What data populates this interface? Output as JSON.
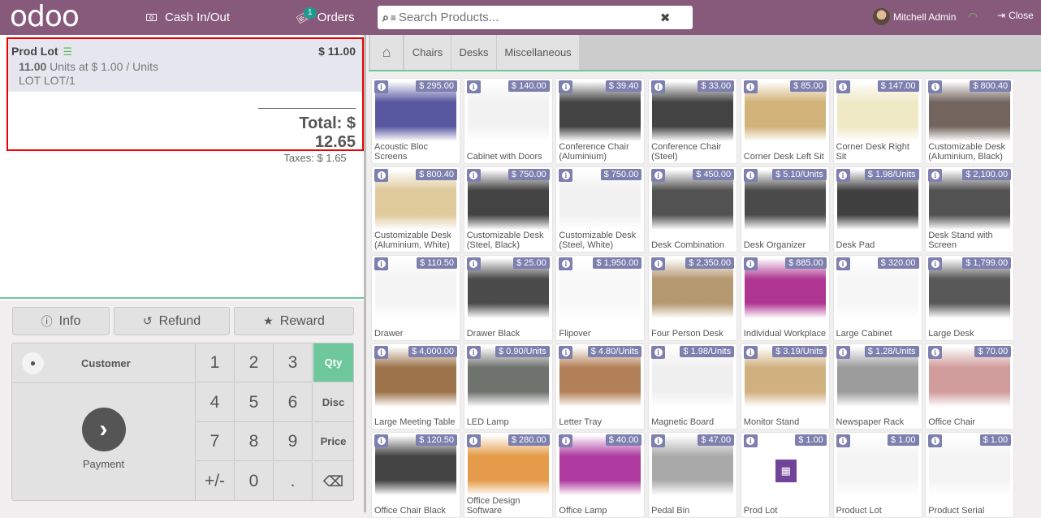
{
  "topbar": {
    "logo": "odoo",
    "cash_label": "Cash In/Out",
    "orders_label": "Orders",
    "orders_count": "1",
    "search_placeholder": "Search Products...",
    "user_name": "Mitchell Admin",
    "close_label": "Close"
  },
  "order": {
    "line": {
      "product": "Prod Lot",
      "price": "$ 11.00",
      "quantity": "11.00",
      "unit_info": "Units at $ 1.00 / Units",
      "lot": "LOT LOT/1"
    },
    "total": "Total: $ 12.65",
    "taxes": "Taxes: $ 1.65"
  },
  "actions": {
    "info": "Info",
    "refund": "Refund",
    "reward": "Reward"
  },
  "numpad": {
    "customer": "Customer",
    "payment": "Payment",
    "keys": [
      "1",
      "2",
      "3",
      "4",
      "5",
      "6",
      "7",
      "8",
      "9",
      "+/-",
      "0",
      "."
    ],
    "modes": [
      "Qty",
      "Disc",
      "Price"
    ],
    "active_mode": "Qty"
  },
  "categories": [
    "Chairs",
    "Desks",
    "Miscellaneous"
  ],
  "products": [
    {
      "name": "Acoustic Bloc Screens",
      "price": "$ 295.00",
      "color": "#3b3a8f"
    },
    {
      "name": "Cabinet with Doors",
      "price": "$ 140.00",
      "color": "#f0f0f0"
    },
    {
      "name": "Conference Chair (Aluminium)",
      "price": "$ 39.40",
      "color": "#222222"
    },
    {
      "name": "Conference Chair (Steel)",
      "price": "$ 33.00",
      "color": "#222222"
    },
    {
      "name": "Corner Desk Left Sit",
      "price": "$ 85.00",
      "color": "#c9a461"
    },
    {
      "name": "Corner Desk Right Sit",
      "price": "$ 147.00",
      "color": "#ece5bc"
    },
    {
      "name": "Customizable Desk (Aluminium, Black)",
      "price": "$ 800.40",
      "color": "#5a4a42"
    },
    {
      "name": "Customizable Desk (Aluminium, White)",
      "price": "$ 800.40",
      "color": "#d9c08a"
    },
    {
      "name": "Customizable Desk (Steel, Black)",
      "price": "$ 750.00",
      "color": "#222222"
    },
    {
      "name": "Customizable Desk (Steel, White)",
      "price": "$ 750.00",
      "color": "#eeeeee"
    },
    {
      "name": "Desk Combination",
      "price": "$ 450.00",
      "color": "#333333"
    },
    {
      "name": "Desk Organizer",
      "price": "$ 5.10/Units",
      "color": "#2a2a2a"
    },
    {
      "name": "Desk Pad",
      "price": "$ 1.98/Units",
      "color": "#1e1e1e"
    },
    {
      "name": "Desk Stand with Screen",
      "price": "$ 2,100.00",
      "color": "#333333"
    },
    {
      "name": "Drawer",
      "price": "$ 110.50",
      "color": "#f2f2f2"
    },
    {
      "name": "Drawer Black",
      "price": "$ 25.00",
      "color": "#2b2b2b"
    },
    {
      "name": "Flipover",
      "price": "$ 1,950.00",
      "color": "#f7f7f7"
    },
    {
      "name": "Four Person Desk",
      "price": "$ 2,350.00",
      "color": "#a88758"
    },
    {
      "name": "Individual Workplace",
      "price": "$ 885.00",
      "color": "#a0137f"
    },
    {
      "name": "Large Cabinet",
      "price": "$ 320.00",
      "color": "#f4f4f4"
    },
    {
      "name": "Large Desk",
      "price": "$ 1,799.00",
      "color": "#3a3a3a"
    },
    {
      "name": "Large Meeting Table",
      "price": "$ 4,000.00",
      "color": "#8a5a2b"
    },
    {
      "name": "LED Lamp",
      "price": "$ 0.90/Units",
      "color": "#555a55"
    },
    {
      "name": "Letter Tray",
      "price": "$ 4.80/Units",
      "color": "#a56a3a"
    },
    {
      "name": "Magnetic Board",
      "price": "$ 1.98/Units",
      "color": "#ececee"
    },
    {
      "name": "Monitor Stand",
      "price": "$ 3.19/Units",
      "color": "#c9a26a"
    },
    {
      "name": "Newspaper Rack",
      "price": "$ 1.28/Units",
      "color": "#8a8a8a"
    },
    {
      "name": "Office Chair",
      "price": "$ 70.00",
      "color": "#c98a8a"
    },
    {
      "name": "Office Chair Black",
      "price": "$ 120.50",
      "color": "#222222"
    },
    {
      "name": "Office Design Software",
      "price": "$ 280.00",
      "color": "#e08a2a"
    },
    {
      "name": "Office Lamp",
      "price": "$ 40.00",
      "color": "#a0178f"
    },
    {
      "name": "Pedal Bin",
      "price": "$ 47.00",
      "color": "#9a9a9a"
    },
    {
      "name": "Prod Lot",
      "price": "$ 1.00",
      "color": "#71449a"
    },
    {
      "name": "Product Lot",
      "price": "$ 1.00",
      "color": "#f2f2f2"
    },
    {
      "name": "Product Serial",
      "price": "$ 1.00",
      "color": "#f2f2f2"
    }
  ]
}
